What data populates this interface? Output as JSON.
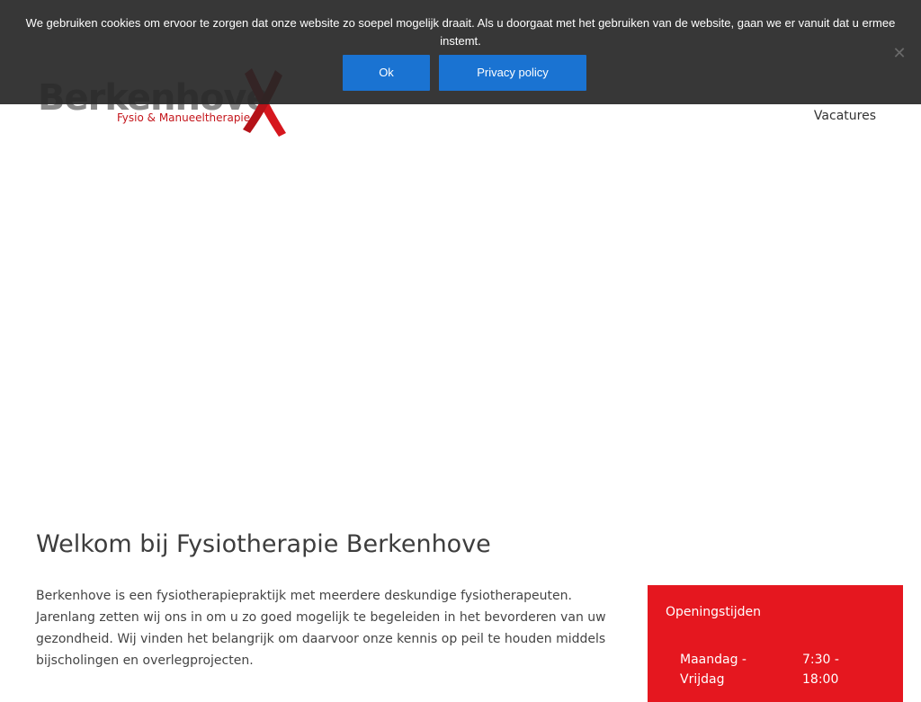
{
  "cookie_notice": {
    "message": "We gebruiken cookies om ervoor te zorgen dat onze website zo soepel mogelijk draait. Als u doorgaat met het gebruiken van de website, gaan we er vanuit dat u ermee instemt.",
    "ok_label": "Ok",
    "privacy_label": "Privacy policy",
    "close_icon": "close-icon"
  },
  "header": {
    "logo": {
      "brand": "Berkenhove",
      "tagline": "Fysio & Manueeltherapie"
    },
    "nav": {
      "vacatures": "Vacatures"
    }
  },
  "main": {
    "title": "Welkom bij Fysiotherapie Berkenhove",
    "intro": "Berkenhove is een fysiotherapiepraktijk met meerdere deskundige fysiotherapeuten. Jarenlang zetten wij ons in om u zo goed mogelijk te begeleiden in het bevorderen van uw gezondheid. Wij vinden het belangrijk om daarvoor onze kennis op peil te houden middels bijscholingen en overlegprojecten."
  },
  "opening_hours": {
    "title": "Openingstijden",
    "rows": [
      {
        "day": "Maandag - Vrijdag",
        "time": "7:30 - 18:00"
      }
    ]
  },
  "colors": {
    "accent_red": "#e5171f",
    "button_blue": "#1a73d2",
    "cookie_bar": "#262626"
  }
}
